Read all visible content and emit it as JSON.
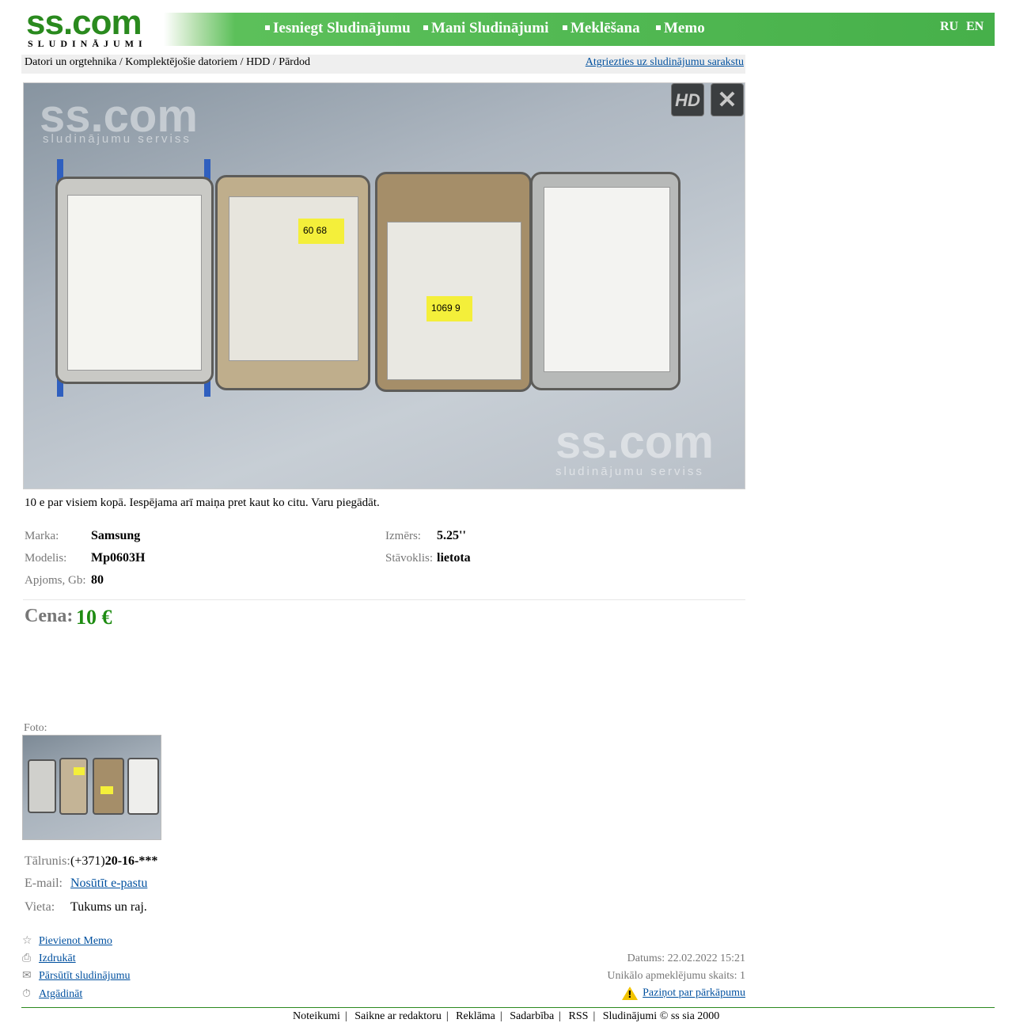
{
  "header": {
    "logo_text": "ss.com",
    "logo_sub": "SLUDINĀJUMI",
    "nav": [
      "Iesniegt Sludinājumu",
      "Mani Sludinājumi",
      "Meklēšana",
      "Memo"
    ],
    "lang": [
      "RU",
      "EN"
    ]
  },
  "breadcrumb": {
    "path": "Datori un orgtehnika / Komplektējošie datoriem / HDD / Pārdod",
    "back_link": "Atgriezties uz sludinājumu sarakstu"
  },
  "photo": {
    "watermark": "ss.com",
    "watermark_sub": "sludinājumu serviss",
    "hd_button": "HD",
    "close_button": "✕",
    "stickers": [
      "60 68",
      "1069 9"
    ]
  },
  "description": "10 e par visiem kopā. Iespējama arī maiņa pret kaut ko citu. Varu piegādāt.",
  "params": {
    "brand_label": "Marka:",
    "brand": "Samsung",
    "model_label": "Modelis:",
    "model": "Mp0603H",
    "capacity_label": "Apjoms, Gb:",
    "capacity": "80",
    "size_label": "Izmērs:",
    "size": "5.25''",
    "condition_label": "Stāvoklis:",
    "condition": "lietota"
  },
  "price": {
    "label": "Cena:",
    "value": "10 €"
  },
  "gallery": {
    "label": "Foto:"
  },
  "contacts": {
    "phone_label": "Tālrunis:",
    "phone_prefix": "(+371)",
    "phone": "20-16-***",
    "email_label": "E-mail:",
    "email_link": "Nosūtīt e-pastu",
    "place_label": "Vieta:",
    "place": "Tukums un raj."
  },
  "actions": {
    "memo": "Pievienot Memo",
    "print": "Izdrukāt",
    "forward": "Pārsūtīt sludinājumu",
    "remind": "Atgādināt",
    "report": "Paziņot par pārkāpumu"
  },
  "meta": {
    "date": "Datums: 22.02.2022 15:21",
    "visits": "Unikālo apmeklējumu skaits: 1"
  },
  "footer": [
    "Noteikumi",
    "Saikne ar redaktoru",
    "Reklāma",
    "Sadarbība",
    "RSS",
    "Sludinājumi © ss sia 2000"
  ],
  "colors": {
    "brand_green": "#46b04a",
    "price_green": "#1e8c12",
    "link_blue": "#00509f"
  }
}
